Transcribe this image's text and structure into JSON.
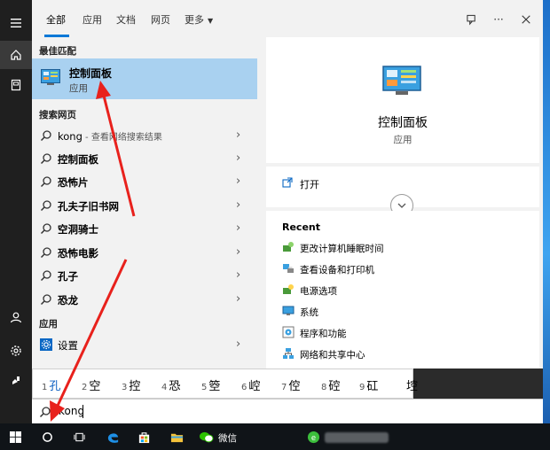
{
  "tabs": {
    "items": [
      "全部",
      "应用",
      "文档",
      "网页",
      "更多"
    ],
    "active": "全部"
  },
  "results": {
    "best_match_title": "最佳匹配",
    "best_match": {
      "name": "控制面板",
      "type": "应用"
    },
    "web_search_title": "搜索网页",
    "web_items": [
      {
        "text": "kong",
        "sub": " - 查看网络搜索结果"
      },
      {
        "text": "控制面板",
        "sub": ""
      },
      {
        "text": "恐怖片",
        "sub": ""
      },
      {
        "text": "孔夫子旧书网",
        "sub": ""
      },
      {
        "text": "空洞骑士",
        "sub": ""
      },
      {
        "text": "恐怖电影",
        "sub": ""
      },
      {
        "text": "孔子",
        "sub": ""
      },
      {
        "text": "恐龙",
        "sub": ""
      }
    ],
    "apps_title": "应用",
    "app_items": [
      {
        "text": "设置"
      }
    ]
  },
  "detail": {
    "name": "控制面板",
    "type": "应用",
    "open_label": "打开",
    "recent_title": "Recent",
    "recent_items": [
      "更改计算机睡眠时间",
      "查看设备和打印机",
      "电源选项",
      "系统",
      "程序和功能",
      "网络和共享中心"
    ]
  },
  "ime": {
    "candidates": [
      {
        "n": "1",
        "c": "孔"
      },
      {
        "n": "2",
        "c": "空"
      },
      {
        "n": "3",
        "c": "控"
      },
      {
        "n": "4",
        "c": "恐"
      },
      {
        "n": "5",
        "c": "箜"
      },
      {
        "n": "6",
        "c": "崆"
      },
      {
        "n": "7",
        "c": "倥"
      },
      {
        "n": "8",
        "c": "硿"
      },
      {
        "n": "9",
        "c": "矼"
      },
      {
        "n": "",
        "c": "埪"
      }
    ]
  },
  "search": {
    "value": "kong"
  },
  "taskbar": {
    "wechat_label": "微信"
  },
  "colors": {
    "accent": "#0078d7",
    "highlight": "#a9d1f0",
    "annotation": "#e8211c"
  }
}
